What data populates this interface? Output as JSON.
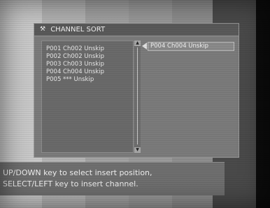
{
  "window": {
    "title": "CHANNEL SORT",
    "title_icon": "wrench-icon"
  },
  "channel_list": [
    "P001 Ch002 Unskip",
    "P002 Ch002 Unskip",
    "P003 Ch003 Unskip",
    "P004 Ch004 Unskip",
    "P005 *** Unskip"
  ],
  "selected_channel": "P004 Ch004 Unskip",
  "help": {
    "line1": "UP/DOWN key to select insert position,",
    "line2": "SELECT/LEFT key to insert channel."
  },
  "colors": {
    "osd_background": "#7b7b7b",
    "title_bar": "#5a5a5a",
    "help_bar": "#6f6f6f",
    "text": "#e8e8e8"
  }
}
